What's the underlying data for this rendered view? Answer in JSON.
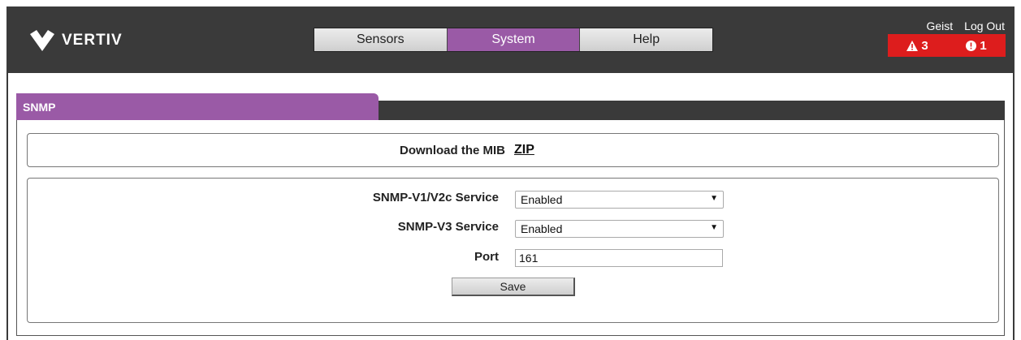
{
  "brand": {
    "name": "VERTIV",
    "logo_icon": "vertiv-chevron-icon"
  },
  "nav": {
    "tabs": [
      {
        "label": "Sensors",
        "active": false
      },
      {
        "label": "System",
        "active": true
      },
      {
        "label": "Help",
        "active": false
      }
    ]
  },
  "user": {
    "name": "Geist",
    "logout_label": "Log Out"
  },
  "alerts": {
    "warning_count": "3",
    "critical_count": "1",
    "color": "#dd1d1d"
  },
  "section": {
    "title": "SNMP",
    "accent_color": "#9a5aa6"
  },
  "mib": {
    "label": "Download the MIB",
    "link_text": "ZIP"
  },
  "form": {
    "v1v2c_label": "SNMP-V1/V2c Service",
    "v1v2c_value": "Enabled",
    "v3_label": "SNMP-V3 Service",
    "v3_value": "Enabled",
    "port_label": "Port",
    "port_value": "161",
    "save_label": "Save"
  }
}
